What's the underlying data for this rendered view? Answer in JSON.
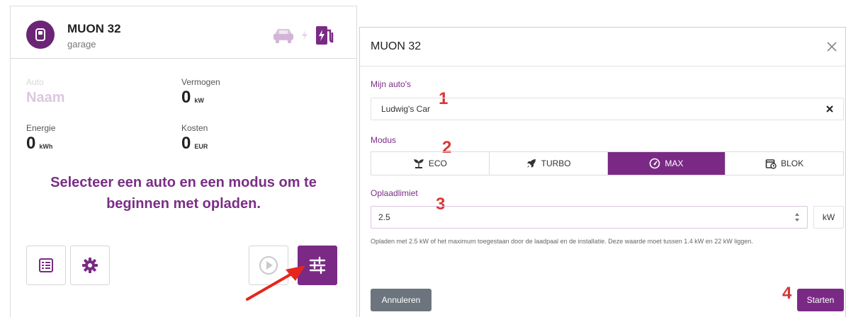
{
  "station": {
    "name": "MUON 32",
    "location": "garage"
  },
  "stats": {
    "auto_label": "Auto",
    "auto_value": "Naam",
    "power_label": "Vermogen",
    "power_value": "0",
    "power_unit": "kW",
    "energy_label": "Energie",
    "energy_value": "0",
    "energy_unit": "kWh",
    "cost_label": "Kosten",
    "cost_value": "0",
    "cost_unit": "EUR"
  },
  "prompt": "Selecteer een auto en een modus om te beginnen met opladen.",
  "colors": {
    "brand": "#7a2a85",
    "accent_text": "#7a2e86",
    "annotation": "#d93636",
    "cancel": "#6c757d"
  },
  "modal": {
    "title": "MUON 32",
    "cars_label": "Mijn auto's",
    "car_value": "Ludwig's Car",
    "mode_label": "Modus",
    "modes": [
      {
        "label": "ECO",
        "icon": "eco-plant-icon",
        "selected": false
      },
      {
        "label": "TURBO",
        "icon": "rocket-icon",
        "selected": false
      },
      {
        "label": "MAX",
        "icon": "gauge-icon",
        "selected": true
      },
      {
        "label": "BLOK",
        "icon": "calendar-icon",
        "selected": false
      }
    ],
    "limit_label": "Oplaadlimiet",
    "limit_value": "2.5",
    "limit_unit": "kW",
    "help_text": "Opladen met 2.5 kW of het maximum toegestaan door de laadpaal en de installatie. Deze waarde moet tussen 1.4 kW en 22 kW liggen.",
    "cancel_label": "Annuleren",
    "start_label": "Starten"
  },
  "annotations": [
    "1",
    "2",
    "3",
    "4"
  ]
}
